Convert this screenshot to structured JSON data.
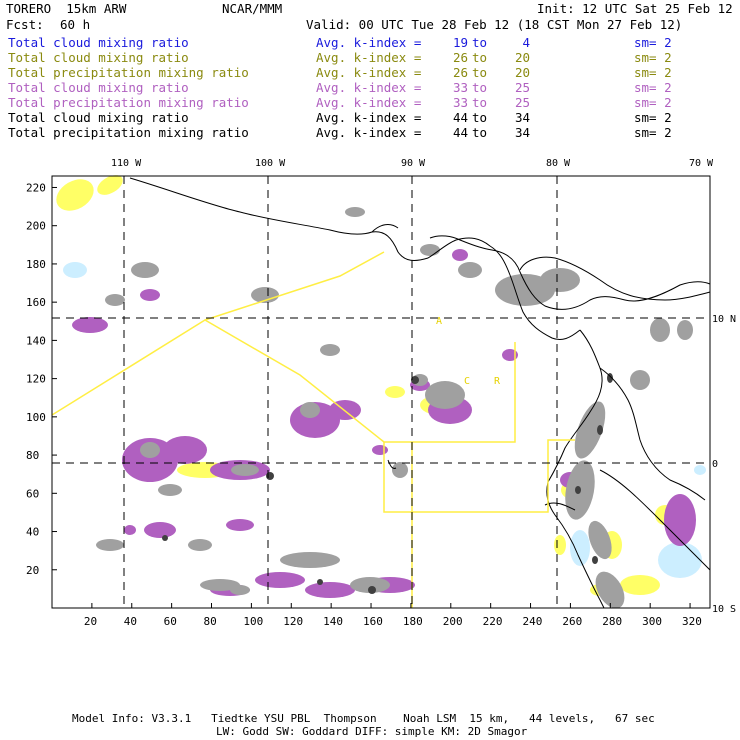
{
  "header": {
    "model": "TORERO  15km ARW",
    "org": "NCAR/MMM",
    "init": "Init: 12 UTC Sat 25 Feb 12",
    "fcst_label": "Fcst:",
    "fcst_value": "60 h",
    "valid": "Valid: 00 UTC Tue 28 Feb 12 (18 CST Mon 27 Feb 12)"
  },
  "legend": [
    {
      "field": "Total cloud mixing ratio",
      "stat": "Avg. k-index =",
      "a": "19",
      "to": "to",
      "b": "4",
      "sm": "sm= 2",
      "color": "#1a1adc",
      "fieldColor": "#1a1adc"
    },
    {
      "field": "Total cloud mixing ratio",
      "stat": "Avg. k-index =",
      "a": "26",
      "to": "to",
      "b": "20",
      "sm": "sm= 2",
      "color": "#8a8a10",
      "fieldColor": "#8a8a10"
    },
    {
      "field": "Total precipitation mixing ratio",
      "stat": "Avg. k-index =",
      "a": "26",
      "to": "to",
      "b": "20",
      "sm": "sm= 2",
      "color": "#8a8a10",
      "fieldColor": "#8a8a10"
    },
    {
      "field": "Total cloud mixing ratio",
      "stat": "Avg. k-index =",
      "a": "33",
      "to": "to",
      "b": "25",
      "sm": "sm= 2",
      "color": "#b060c0",
      "fieldColor": "#b060c0"
    },
    {
      "field": "Total precipitation mixing ratio",
      "stat": "Avg. k-index =",
      "a": "33",
      "to": "to",
      "b": "25",
      "sm": "sm= 2",
      "color": "#b060c0",
      "fieldColor": "#b060c0"
    },
    {
      "field": "Total cloud mixing ratio",
      "stat": "Avg. k-index =",
      "a": "44",
      "to": "to",
      "b": "34",
      "sm": "sm= 2",
      "color": "#000000",
      "fieldColor": "#000000"
    },
    {
      "field": "Total precipitation mixing ratio",
      "stat": "Avg. k-index =",
      "a": "44",
      "to": "to",
      "b": "34",
      "sm": "sm= 2",
      "color": "#000000",
      "fieldColor": "#000000"
    }
  ],
  "map": {
    "lon_labels": [
      "110 W",
      "100 W",
      "90 W",
      "80 W",
      "70 W"
    ],
    "lat_labels": [
      "10 N",
      "0",
      "10 S"
    ],
    "x_ticks": [
      "20",
      "40",
      "60",
      "80",
      "100",
      "120",
      "140",
      "160",
      "180",
      "200",
      "220",
      "240",
      "260",
      "280",
      "300",
      "320"
    ],
    "y_ticks": [
      "220",
      "200",
      "180",
      "160",
      "140",
      "120",
      "100",
      "80",
      "60",
      "40",
      "20"
    ],
    "region_labels": [
      "A",
      "C",
      "R"
    ],
    "colors": {
      "cloud_19_4": "#cceeff",
      "cloud_26_20": "#ffff66",
      "precip_33_25": "#b060c0",
      "cloud_44_34": "#a0a0a0",
      "box": "#ffee44"
    }
  },
  "footer": {
    "line1": "Model Info: V3.3.1   Tiedtke YSU PBL  Thompson    Noah LSM  15 km,   44 levels,   67 sec",
    "line2": "LW: Godd SW: Goddard DIFF: simple KM: 2D Smagor"
  }
}
